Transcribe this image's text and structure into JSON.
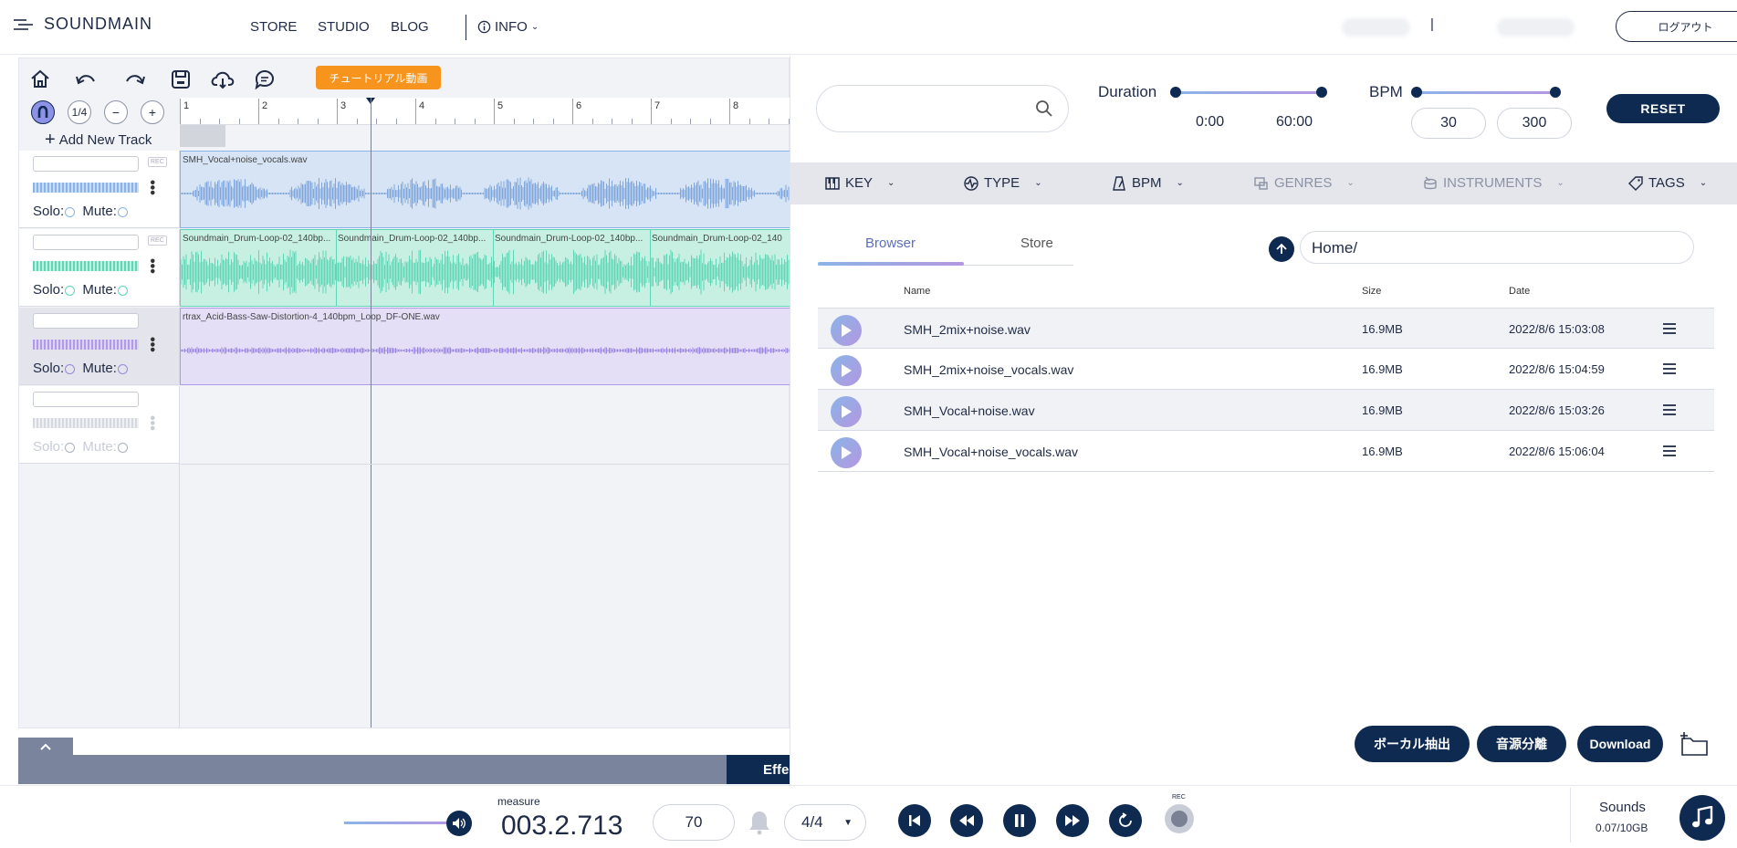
{
  "header": {
    "logo": "SOUNDMAIN",
    "nav": [
      "STORE",
      "STUDIO",
      "BLOG"
    ],
    "info": "INFO",
    "separator": "|",
    "logout": "ログアウト"
  },
  "daw": {
    "tutorial": "チュートリアル動画",
    "snap": "1/4",
    "add_track": "Add New Track",
    "ruler": [
      "1",
      "2",
      "3",
      "4",
      "5",
      "6",
      "7",
      "8"
    ],
    "rec": "REC",
    "tracks": [
      {
        "solo": "Solo:",
        "mute": "Mute:",
        "color": "#8ab4e8",
        "clips": [
          "SMH_Vocal+noise_vocals.wav"
        ]
      },
      {
        "solo": "Solo:",
        "mute": "Mute:",
        "color": "#5fd6b5",
        "clips": [
          "Soundmain_Drum-Loop-02_140bp...",
          "Soundmain_Drum-Loop-02_140bp...",
          "Soundmain_Drum-Loop-02_140bp...",
          "Soundmain_Drum-Loop-02_140"
        ]
      },
      {
        "solo": "Solo:",
        "mute": "Mute:",
        "color": "#b09ae6",
        "clips": [
          "rtrax_Acid-Bass-Saw-Distortion-4_140bpm_Loop_DF-ONE.wav"
        ]
      },
      {
        "solo": "Solo:",
        "mute": "Mute:",
        "color": "#c8ccd6",
        "clips": []
      }
    ],
    "effects_tab": "Effe"
  },
  "browser": {
    "duration_label": "Duration",
    "duration_min": "0:00",
    "duration_max": "60:00",
    "bpm_label": "BPM",
    "bpm_min": "30",
    "bpm_max": "300",
    "reset": "RESET",
    "filters": {
      "key": "KEY",
      "type": "TYPE",
      "bpm": "BPM",
      "genres": "GENRES",
      "instruments": "INSTRUMENTS",
      "tags": "TAGS"
    },
    "tabs": {
      "browser": "Browser",
      "store": "Store"
    },
    "path": "Home/",
    "columns": {
      "name": "Name",
      "size": "Size",
      "date": "Date"
    },
    "files": [
      {
        "name": "SMH_2mix+noise.wav",
        "size": "16.9MB",
        "date": "2022/8/6 15:03:08"
      },
      {
        "name": "SMH_2mix+noise_vocals.wav",
        "size": "16.9MB",
        "date": "2022/8/6 15:04:59"
      },
      {
        "name": "SMH_Vocal+noise.wav",
        "size": "16.9MB",
        "date": "2022/8/6 15:03:26"
      },
      {
        "name": "SMH_Vocal+noise_vocals.wav",
        "size": "16.9MB",
        "date": "2022/8/6 15:06:04"
      }
    ],
    "actions": {
      "vocal": "ボーカル抽出",
      "separate": "音源分離",
      "download": "Download"
    }
  },
  "transport": {
    "measure_label": "measure",
    "measure": "003.2.713",
    "tempo": "70",
    "time_sig": "4/4",
    "rec": "REC",
    "sounds_label": "Sounds",
    "sounds_usage": "0.07/10GB"
  }
}
